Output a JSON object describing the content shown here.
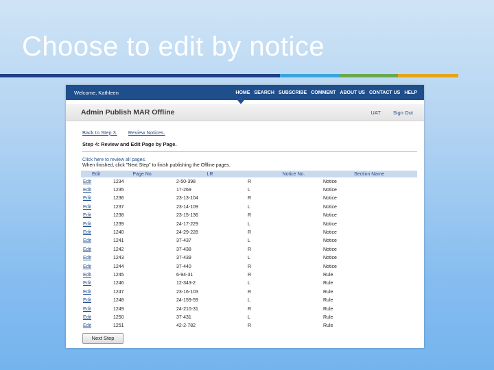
{
  "slide": {
    "title": "Choose to edit by notice",
    "accent_colors": [
      "#1f3f86",
      "#3aa5dc",
      "#6aa84f",
      "#e3a51a"
    ]
  },
  "app": {
    "welcome": "Welcome, Kathleen",
    "nav": [
      "HOME",
      "SEARCH",
      "SUBSCRIBE",
      "COMMENT",
      "ABOUT US",
      "CONTACT US",
      "HELP"
    ],
    "title": "Admin Publish MAR Offline",
    "env": "UAT",
    "signout": "Sign Out",
    "back_link": "Back to Step 3.",
    "review_link": "Review Notices.",
    "step_heading": "Step 4: Review and Edit Page by Page.",
    "review_all": "Click here to review all pages.",
    "instructions": "When finished, click \"Next Step\" to finish publishing the Offline pages.",
    "next_button": "Next Step"
  },
  "table": {
    "columns": [
      "Edit",
      "Page No.",
      "LR",
      "",
      "Notice No.",
      "Section Name"
    ],
    "rows": [
      [
        "Edit",
        "1234",
        "2-50-398",
        "R",
        "",
        "Notice"
      ],
      [
        "Edit",
        "1235",
        "17-269",
        "L",
        "",
        "Notice"
      ],
      [
        "Edit",
        "1236",
        "23-13-104",
        "R",
        "",
        "Notice"
      ],
      [
        "Edit",
        "1237",
        "23-14-109",
        "L",
        "",
        "Notice"
      ],
      [
        "Edit",
        "1238",
        "23-15-136",
        "R",
        "",
        "Notice"
      ],
      [
        "Edit",
        "1239",
        "24-17-229",
        "L",
        "",
        "Notice"
      ],
      [
        "Edit",
        "1240",
        "24-29-228",
        "R",
        "",
        "Notice"
      ],
      [
        "Edit",
        "1241",
        "37-437",
        "L",
        "",
        "Notice"
      ],
      [
        "Edit",
        "1242",
        "37-438",
        "R",
        "",
        "Notice"
      ],
      [
        "Edit",
        "1243",
        "37-439",
        "L",
        "",
        "Notice"
      ],
      [
        "Edit",
        "1244",
        "37-440",
        "R",
        "",
        "Notice"
      ],
      [
        "Edit",
        "1245",
        "6-94-31",
        "R",
        "",
        "Rule"
      ],
      [
        "Edit",
        "1246",
        "12-343-2",
        "L",
        "",
        "Rule"
      ],
      [
        "Edit",
        "1247",
        "23-16-103",
        "R",
        "",
        "Rule"
      ],
      [
        "Edit",
        "1248",
        "24-159-59",
        "L",
        "",
        "Rule"
      ],
      [
        "Edit",
        "1249",
        "24-210-31",
        "R",
        "",
        "Rule"
      ],
      [
        "Edit",
        "1250",
        "37-431",
        "L",
        "",
        "Rule"
      ],
      [
        "Edit",
        "1251",
        "42-2-782",
        "R",
        "",
        "Rule"
      ]
    ]
  }
}
